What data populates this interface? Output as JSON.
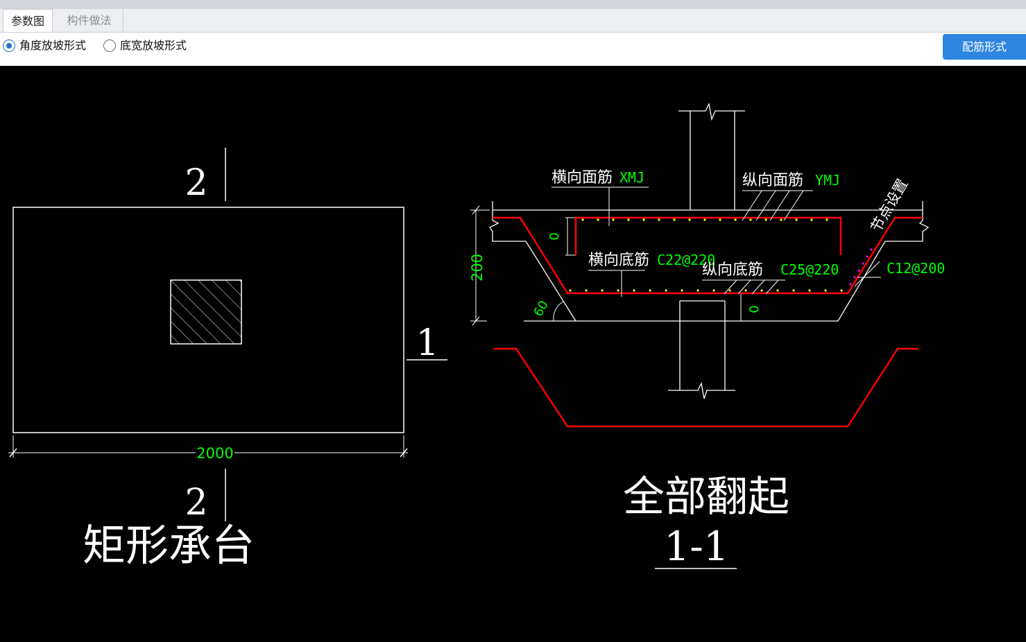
{
  "tabs": [
    {
      "label": "参数图",
      "active": true
    },
    {
      "label": "构件做法",
      "active": false
    }
  ],
  "options": {
    "angle_slope": {
      "label": "角度放坡形式",
      "checked": true
    },
    "base_width_slope": {
      "label": "底宽放坡形式",
      "checked": false
    }
  },
  "rebar_form_button": "配筋形式",
  "drawing": {
    "plan": {
      "section_mark_top": "2",
      "section_mark_right": "1",
      "section_mark_bottom": "2",
      "width_dim": "2000",
      "title": "矩形承台"
    },
    "section": {
      "top_transverse_label": "横向面筋",
      "top_transverse_value": "XMJ",
      "top_longitudinal_label": "纵向面筋",
      "top_longitudinal_value": "YMJ",
      "node_setting": "节点设置",
      "top_cover": "0",
      "bottom_transverse_label": "横向底筋",
      "bottom_transverse_value": "C22@220",
      "bottom_longitudinal_label": "纵向底筋",
      "bottom_longitudinal_value": "C25@220",
      "side_rebar_value": "C12@200",
      "height_dim": "200",
      "slope_angle": "60",
      "bottom_cover": "0",
      "title": "全部翻起",
      "section_id": "1-1"
    }
  },
  "colors": {
    "canvas_bg": "#000000",
    "line": "#ffffff",
    "dimension_text": "#00ff00",
    "rebar": "#ff0000",
    "rebar_points": "#ffff00",
    "node_marker": "#ff00ff",
    "button_bg": "#2f86e0",
    "radio_accent": "#1f6fd1"
  }
}
